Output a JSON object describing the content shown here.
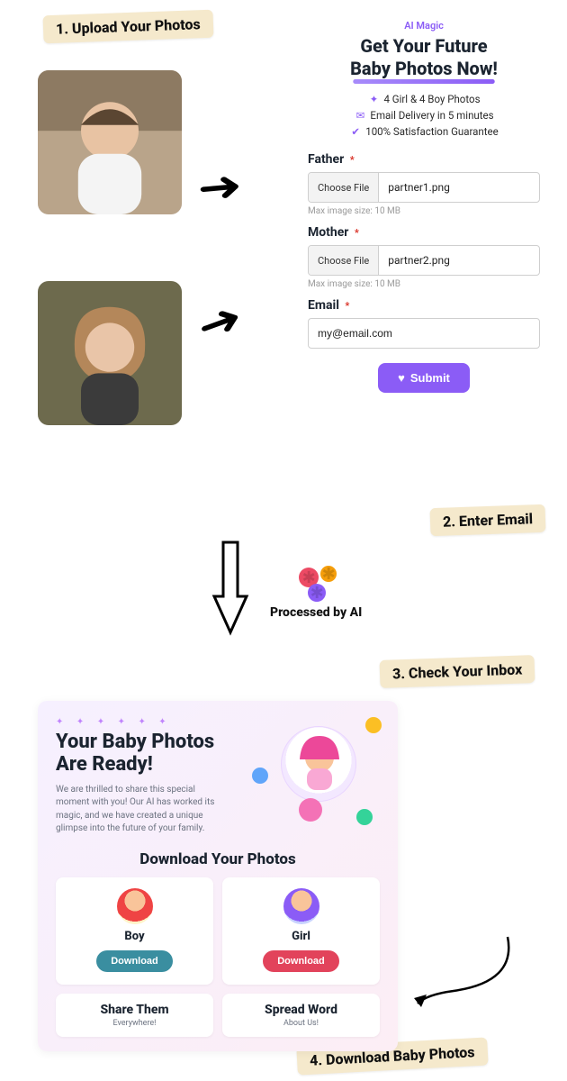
{
  "steps": {
    "s1": "1. Upload Your Photos",
    "s2": "2. Enter Email",
    "s3": "3. Check Your Inbox",
    "s4": "4. Download Baby Photos"
  },
  "form": {
    "ai_magic": "AI Magic",
    "title_line1": "Get Your Future",
    "title_line2": "Baby Photos Now!",
    "features": {
      "f1": "4 Girl & 4 Boy Photos",
      "f2": "Email Delivery in 5 minutes",
      "f3": "100% Satisfaction Guarantee"
    },
    "father_label": "Father",
    "mother_label": "Mother",
    "choose_file": "Choose File",
    "father_file": "partner1.png",
    "mother_file": "partner2.png",
    "max_hint": "Max image size: 10 MB",
    "email_label": "Email",
    "email_value": "my@email.com",
    "submit": "Submit",
    "required_mark": "*"
  },
  "processed": {
    "label": "Processed by AI"
  },
  "result": {
    "heading": "Your Baby Photos Are Ready!",
    "body": "We are thrilled to share this special moment with you! Our AI has worked its magic, and we have created a unique glimpse into the future of your family.",
    "download_heading": "Download Your Photos",
    "boy_label": "Boy",
    "girl_label": "Girl",
    "download_btn": "Download",
    "share_title": "Share Them",
    "share_sub": "Everywhere!",
    "spread_title": "Spread Word",
    "spread_sub": "About Us!"
  }
}
